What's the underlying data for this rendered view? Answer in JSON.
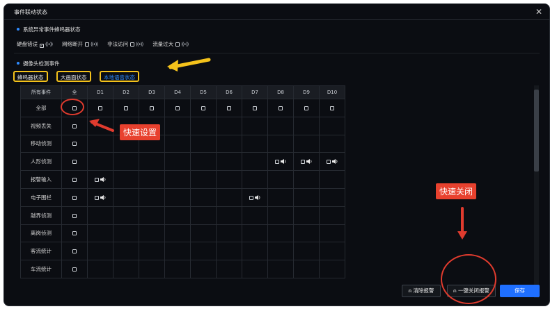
{
  "window": {
    "title": "事件联动状态"
  },
  "section1": {
    "title": "系统异常事件蜂鸣器状态",
    "items": [
      {
        "label": "硬盘错误",
        "checked": true
      },
      {
        "label": "网络断开",
        "checked": false
      },
      {
        "label": "非法访问",
        "checked": false
      },
      {
        "label": "流量过大",
        "checked": false
      }
    ]
  },
  "section2": {
    "title": "摄像头检测事件"
  },
  "tabs": [
    {
      "label": "蜂鸣器状态",
      "active": false
    },
    {
      "label": "大画面状态",
      "active": false
    },
    {
      "label": "本地语音状态",
      "active": true
    }
  ],
  "grid": {
    "columns": [
      "所有事件",
      "全",
      "D1",
      "D2",
      "D3",
      "D4",
      "D5",
      "D6",
      "D7",
      "D8",
      "D9",
      "D10"
    ],
    "rows": [
      {
        "label": "全部",
        "all": true,
        "cells": [
          true,
          true,
          true,
          true,
          true,
          true,
          true,
          true,
          true,
          true
        ],
        "speaker": [
          false,
          false,
          false,
          false,
          false,
          false,
          false,
          false,
          false,
          false
        ]
      },
      {
        "label": "视频丢失",
        "all": true,
        "cells": [
          false,
          false,
          false,
          false,
          false,
          false,
          false,
          false,
          false,
          false
        ],
        "speaker": [
          false,
          false,
          false,
          false,
          false,
          false,
          false,
          false,
          false,
          false
        ]
      },
      {
        "label": "移动侦测",
        "all": true,
        "cells": [
          false,
          false,
          false,
          false,
          false,
          false,
          false,
          false,
          false,
          false
        ],
        "speaker": [
          false,
          false,
          false,
          false,
          false,
          false,
          false,
          false,
          false,
          false
        ]
      },
      {
        "label": "人形侦测",
        "all": true,
        "cells": [
          false,
          false,
          false,
          false,
          false,
          false,
          false,
          true,
          true,
          true
        ],
        "speaker": [
          false,
          false,
          false,
          false,
          false,
          false,
          false,
          true,
          true,
          true
        ]
      },
      {
        "label": "报警输入",
        "all": true,
        "cells": [
          true,
          false,
          false,
          false,
          false,
          false,
          false,
          false,
          false,
          false
        ],
        "speaker": [
          true,
          false,
          false,
          false,
          false,
          false,
          false,
          false,
          false,
          false
        ]
      },
      {
        "label": "电子围栏",
        "all": true,
        "cells": [
          true,
          false,
          false,
          false,
          false,
          false,
          true,
          false,
          false,
          false
        ],
        "speaker": [
          true,
          false,
          false,
          false,
          false,
          false,
          true,
          false,
          false,
          false
        ]
      },
      {
        "label": "越界侦测",
        "all": true,
        "cells": [
          false,
          false,
          false,
          false,
          false,
          false,
          false,
          false,
          false,
          false
        ],
        "speaker": [
          false,
          false,
          false,
          false,
          false,
          false,
          false,
          false,
          false,
          false
        ]
      },
      {
        "label": "离岗侦测",
        "all": true,
        "cells": [
          false,
          false,
          false,
          false,
          false,
          false,
          false,
          false,
          false,
          false
        ],
        "speaker": [
          false,
          false,
          false,
          false,
          false,
          false,
          false,
          false,
          false,
          false
        ]
      },
      {
        "label": "客流统计",
        "all": true,
        "cells": [
          false,
          false,
          false,
          false,
          false,
          false,
          false,
          false,
          false,
          false
        ],
        "speaker": [
          false,
          false,
          false,
          false,
          false,
          false,
          false,
          false,
          false,
          false
        ]
      },
      {
        "label": "车流统计",
        "all": true,
        "cells": [
          false,
          false,
          false,
          false,
          false,
          false,
          false,
          false,
          false,
          false
        ],
        "speaker": [
          false,
          false,
          false,
          false,
          false,
          false,
          false,
          false,
          false,
          false
        ]
      }
    ]
  },
  "buttons": {
    "clear": "清除报警",
    "close_all": "一键关闭报警",
    "save": "保存"
  },
  "annotations": {
    "quick_set": "快速设置",
    "quick_close": "快速关闭"
  },
  "colors": {
    "accent": "#1f6fff",
    "highlight": "#f4c21b",
    "annotation": "#e8412e"
  }
}
